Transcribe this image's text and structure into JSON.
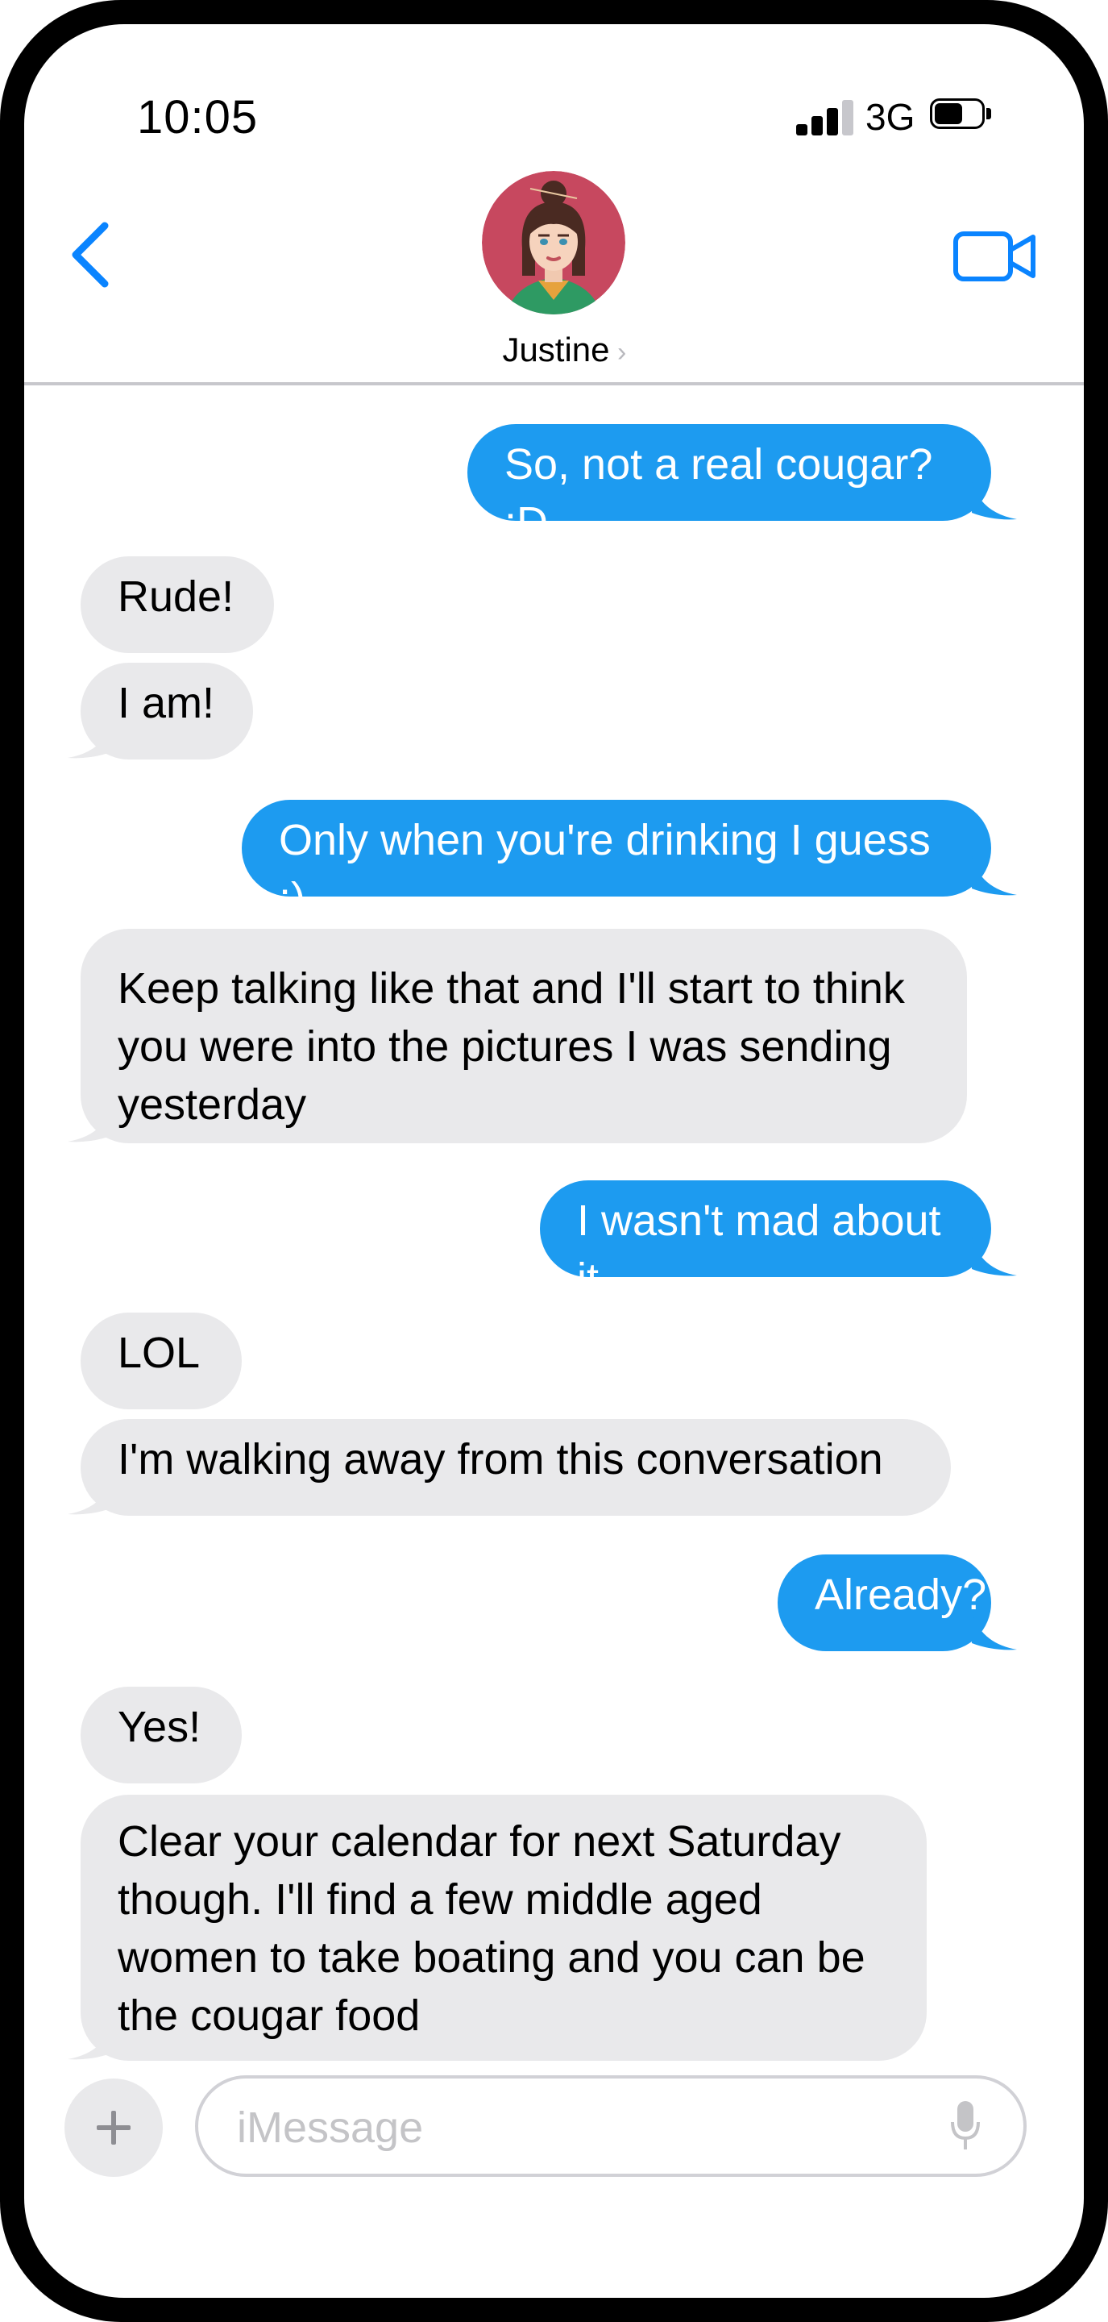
{
  "status_bar": {
    "time": "10:05",
    "network": "3G"
  },
  "header": {
    "contact_name": "Justine"
  },
  "messages": [
    {
      "from": "me",
      "text": "So, not a real cougar? :D"
    },
    {
      "from": "them",
      "text": "Rude!"
    },
    {
      "from": "them",
      "text": "I am!"
    },
    {
      "from": "me",
      "text": "Only when you're drinking I guess ;)"
    },
    {
      "from": "them",
      "text": "Keep talking like that and I'll start to think\nyou were into the pictures I was sending\nyesterday"
    },
    {
      "from": "me",
      "text": "I wasn't mad about it"
    },
    {
      "from": "them",
      "text": "LOL"
    },
    {
      "from": "them",
      "text": "I'm walking away from this conversation"
    },
    {
      "from": "me",
      "text": "Already?"
    },
    {
      "from": "them",
      "text": "Yes!"
    },
    {
      "from": "them",
      "text": "Clear your calendar for next Saturday\nthough.  I'll find a few middle aged\nwomen to take boating and you can be\nthe cougar food"
    }
  ],
  "composer": {
    "placeholder": "iMessage"
  },
  "colors": {
    "sent_bubble": "#1d9bf0",
    "received_bubble": "#e9e9eb",
    "accent": "#0a84ff"
  }
}
